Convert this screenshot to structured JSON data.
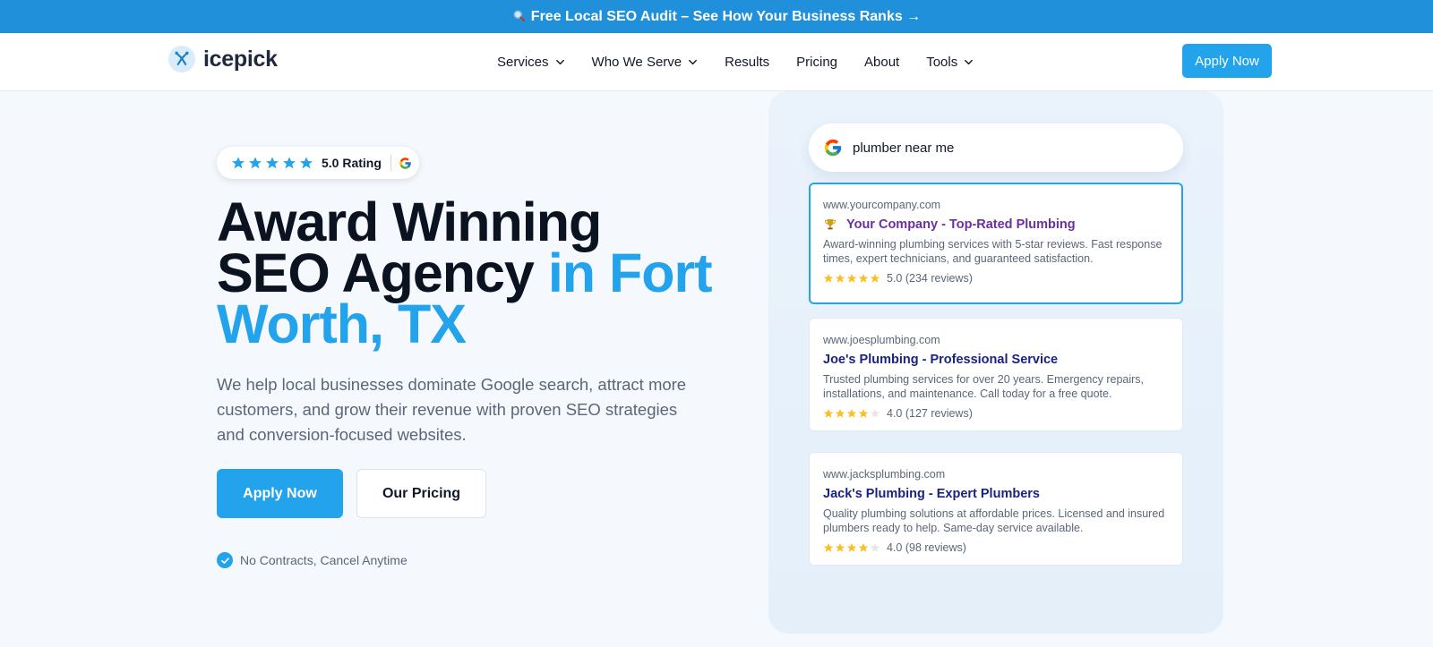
{
  "banner": {
    "icon": "magnifying-glass-icon",
    "text": "Free Local SEO Audit – See How Your Business Ranks →"
  },
  "nav": {
    "brand": "icepick",
    "menu": [
      {
        "label": "Services",
        "dropdown": true
      },
      {
        "label": "Who We Serve",
        "dropdown": true
      },
      {
        "label": "Results",
        "dropdown": false
      },
      {
        "label": "Pricing",
        "dropdown": false
      },
      {
        "label": "About",
        "dropdown": false
      },
      {
        "label": "Tools",
        "dropdown": true
      }
    ],
    "cta": "Apply Now"
  },
  "hero": {
    "rating": {
      "stars": 5,
      "label": "5.0 Rating",
      "icon": "google-icon"
    },
    "headline_line1": "Award Winning",
    "headline_line2": "SEO Agency",
    "headline_accent_part1": "in Fort",
    "headline_accent_part2": "Worth, TX",
    "lead": "We help local businesses dominate Google search, attract more customers, and grow their revenue with proven SEO strategies and conversion-focused websites.",
    "primary_cta": "Apply Now",
    "secondary_cta": "Our Pricing",
    "guarantee": "No Contracts, Cancel Anytime"
  },
  "serp": {
    "query": "plumber near me",
    "results": [
      {
        "url": "www.yourcompany.com",
        "title": "Your Company - Top-Rated Plumbing",
        "icon": "trophy-icon",
        "description": "Award-winning plumbing services with 5-star reviews. Fast response times, expert technicians, and guaranteed satisfaction.",
        "stars": 5,
        "rating_text": "5.0 (234 reviews)"
      },
      {
        "url": "www.joesplumbing.com",
        "title": "Joe's Plumbing - Professional Service",
        "description": "Trusted plumbing services for over 20 years. Emergency repairs, installations, and maintenance. Call today for a free quote.",
        "stars": 4,
        "rating_text": "4.0 (127 reviews)"
      },
      {
        "url": "www.jacksplumbing.com",
        "title": "Jack's Plumbing - Expert Plumbers",
        "description": "Quality plumbing solutions at affordable prices. Licensed and insured plumbers ready to help. Same-day service available.",
        "stars": 4,
        "rating_text": "4.0 (98 reviews)"
      }
    ]
  },
  "colors": {
    "brand_blue": "#23a3eb",
    "banner_blue": "#2190db",
    "star_yellow": "#fbbf24",
    "featured_title": "#6b2fa0",
    "result_title": "#1a237e"
  }
}
